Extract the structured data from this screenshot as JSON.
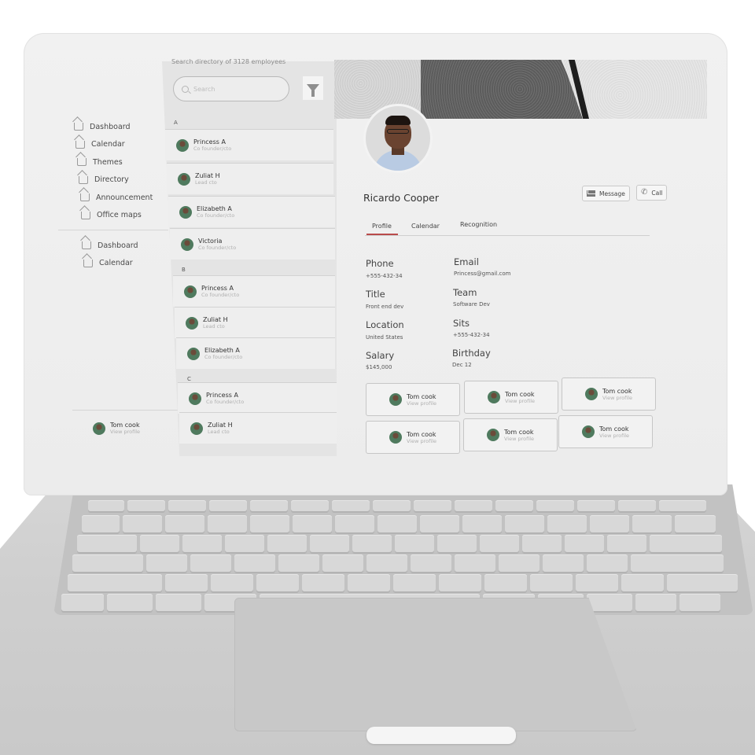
{
  "nav": {
    "primary": [
      "Dashboard",
      "Calendar",
      "Themes",
      "Directory",
      "Announcement",
      "Office maps"
    ],
    "secondary": [
      "Dashboard",
      "Calendar"
    ],
    "user": {
      "name": "Tom cook",
      "sub": "View profile"
    }
  },
  "directory": {
    "caption": "Search directory of 3128 employees",
    "search_placeholder": "Search",
    "groups": [
      {
        "letter": "A",
        "people": [
          {
            "name": "Princess A",
            "role": "Co founder/cto"
          },
          {
            "name": "Zuliat H",
            "role": "Lead cto"
          },
          {
            "name": "Elizabeth A",
            "role": "Co founder/cto"
          },
          {
            "name": "Victoria",
            "role": "Co founder/cto"
          }
        ]
      },
      {
        "letter": "B",
        "people": [
          {
            "name": "Princess A",
            "role": "Co founder/cto"
          },
          {
            "name": "Zuliat H",
            "role": "Lead cto"
          },
          {
            "name": "Elizabeth A",
            "role": "Co founder/cto"
          }
        ]
      },
      {
        "letter": "C",
        "people": [
          {
            "name": "Princess A",
            "role": "Co founder/cto"
          },
          {
            "name": "Zuliat H",
            "role": "Lead cto"
          }
        ]
      }
    ]
  },
  "profile": {
    "name": "Ricardo Cooper",
    "message_label": "Message",
    "call_label": "Call",
    "tabs": [
      "Profile",
      "Calendar",
      "Recognition"
    ],
    "fields": {
      "phone": {
        "label": "Phone",
        "value": "+555-432-34"
      },
      "email": {
        "label": "Email",
        "value": "Princess@gmail.com"
      },
      "title": {
        "label": "Title",
        "value": "Front end dev"
      },
      "team": {
        "label": "Team",
        "value": "Software Dev"
      },
      "location": {
        "label": "Location",
        "value": "United States"
      },
      "sits": {
        "label": "Sits",
        "value": "+555-432-34"
      },
      "salary": {
        "label": "Salary",
        "value": "$145,000"
      },
      "birthday": {
        "label": "Birthday",
        "value": "Dec 12"
      }
    },
    "cards": [
      {
        "name": "Tom cook",
        "sub": "View profile"
      },
      {
        "name": "Tom cook",
        "sub": "View profile"
      },
      {
        "name": "Tom cook",
        "sub": "View profile"
      },
      {
        "name": "Tom cook",
        "sub": "View profile"
      },
      {
        "name": "Tom cook",
        "sub": "View profile"
      },
      {
        "name": "Tom cook",
        "sub": "View profile"
      }
    ]
  },
  "colors": {
    "accent": "#b94b4b",
    "screen_bg": "#f1f1f1",
    "laptop_gray": "#d0d0d0"
  }
}
